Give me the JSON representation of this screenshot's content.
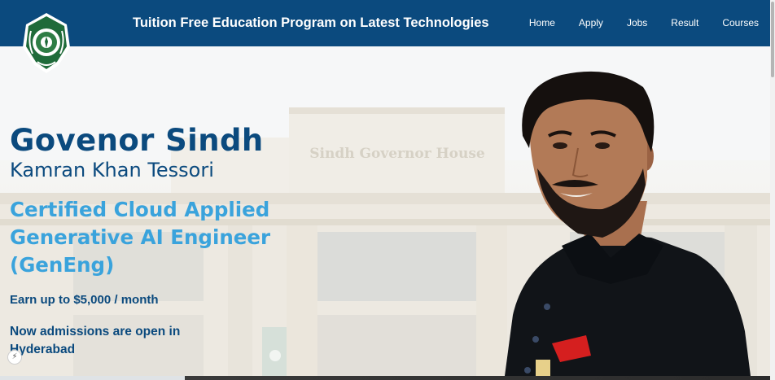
{
  "header": {
    "title": "Tuition Free Education Program on Latest Technologies",
    "logo_icon": "sindh-governor-emblem-icon",
    "nav": [
      {
        "label": "Home"
      },
      {
        "label": "Apply"
      },
      {
        "label": "Jobs"
      },
      {
        "label": "Result"
      },
      {
        "label": "Courses"
      }
    ]
  },
  "hero": {
    "name": "Govenor Sindh",
    "subtitle": "Kamran Khan Tessori",
    "program": "Certified Cloud Applied Generative AI Engineer (GenEng)",
    "earn": "Earn up to $5,000 / month",
    "admissions": "Now admissions are open in Hyderabad",
    "building_sign": "Sindh Governor House"
  },
  "colors": {
    "navbar": "#0b4a7e",
    "heading": "#0b4a7e",
    "accent": "#3aa3dc"
  }
}
